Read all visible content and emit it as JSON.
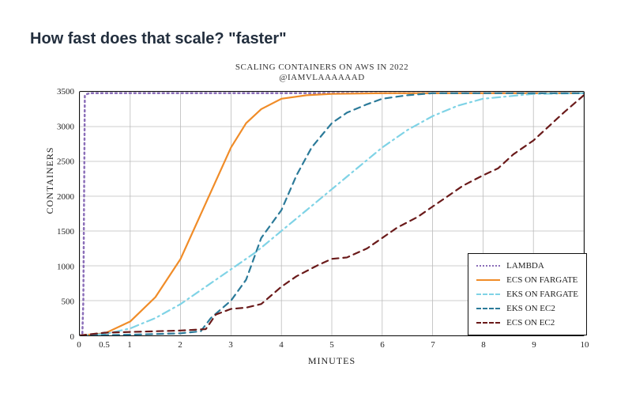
{
  "page_title": "How fast does that scale? \"faster\"",
  "chart_data": {
    "type": "line",
    "title": "SCALING CONTAINERS ON AWS IN 2022\n@IAMVLAAAAAAD",
    "xlabel": "MINUTES",
    "ylabel": "CONTAINERS",
    "xlim": [
      0,
      10
    ],
    "ylim": [
      0,
      3500
    ],
    "x_ticks": [
      "0",
      "0.5",
      "1",
      "2",
      "3",
      "4",
      "5",
      "6",
      "7",
      "8",
      "9",
      "10"
    ],
    "y_ticks": [
      "0",
      "500",
      "1000",
      "1500",
      "2000",
      "2500",
      "3000",
      "3500"
    ],
    "grid": true,
    "legend_position": "lower-right",
    "series": [
      {
        "name": "LAMBDA",
        "color": "#8a6db8",
        "style": "dotted",
        "x": [
          0,
          0.05,
          0.07,
          0.1,
          0.15,
          0.2,
          10
        ],
        "values": [
          0,
          0,
          500,
          3450,
          3470,
          3480,
          3480
        ]
      },
      {
        "name": "ECS ON FARGATE",
        "color": "#f08c28",
        "style": "solid",
        "x": [
          0,
          0.5,
          1,
          1.5,
          2,
          2.5,
          3,
          3.3,
          3.6,
          4,
          4.5,
          5,
          6,
          10
        ],
        "values": [
          0,
          30,
          200,
          550,
          1100,
          1900,
          2700,
          3050,
          3250,
          3400,
          3450,
          3470,
          3480,
          3480
        ]
      },
      {
        "name": "EKS ON FARGATE",
        "color": "#7fd3e6",
        "style": "dashdot",
        "x": [
          0,
          0.5,
          1,
          1.5,
          2,
          2.5,
          3,
          3.5,
          4,
          4.5,
          5,
          5.5,
          6,
          6.5,
          7,
          7.5,
          8,
          9,
          10
        ],
        "values": [
          0,
          20,
          100,
          250,
          450,
          700,
          950,
          1200,
          1500,
          1800,
          2100,
          2400,
          2700,
          2950,
          3150,
          3300,
          3400,
          3470,
          3480
        ]
      },
      {
        "name": "EKS ON EC2",
        "color": "#2b7a99",
        "style": "dashed",
        "x": [
          0,
          1,
          2,
          2.4,
          2.6,
          3,
          3.3,
          3.6,
          4,
          4.3,
          4.6,
          5,
          5.3,
          5.7,
          6,
          6.5,
          7,
          8,
          10
        ],
        "values": [
          0,
          10,
          30,
          60,
          250,
          500,
          800,
          1400,
          1800,
          2300,
          2700,
          3050,
          3200,
          3320,
          3400,
          3450,
          3480,
          3480,
          3480
        ]
      },
      {
        "name": "ECS ON EC2",
        "color": "#6a1a1a",
        "style": "dashed",
        "x": [
          0,
          0.5,
          1,
          1.5,
          2,
          2.5,
          2.7,
          3,
          3.3,
          3.6,
          4,
          4.3,
          4.7,
          5,
          5.3,
          5.7,
          6,
          6.3,
          6.7,
          7,
          7.3,
          7.6,
          8,
          8.3,
          8.6,
          9,
          9.3,
          9.6,
          10
        ],
        "values": [
          0,
          40,
          50,
          60,
          70,
          90,
          300,
          380,
          400,
          450,
          700,
          850,
          1000,
          1100,
          1120,
          1250,
          1400,
          1550,
          1700,
          1850,
          2000,
          2150,
          2300,
          2400,
          2600,
          2800,
          3000,
          3200,
          3450
        ]
      }
    ]
  },
  "legend": [
    {
      "label": "LAMBDA",
      "color": "#8a6db8",
      "style": "dotted"
    },
    {
      "label": "ECS ON FARGATE",
      "color": "#f08c28",
      "style": "solid"
    },
    {
      "label": "EKS ON FARGATE",
      "color": "#7fd3e6",
      "style": "dashdot"
    },
    {
      "label": "EKS ON EC2",
      "color": "#2b7a99",
      "style": "dashed"
    },
    {
      "label": "ECS ON EC2",
      "color": "#6a1a1a",
      "style": "dashed"
    }
  ]
}
